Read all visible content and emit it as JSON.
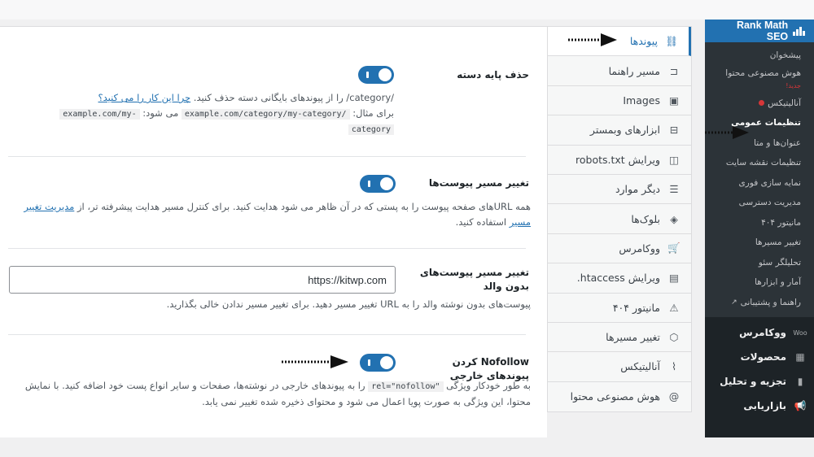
{
  "sidebar": {
    "brand": "Rank Math SEO",
    "submenu": [
      {
        "label": "پیشخوان"
      },
      {
        "label": "هوش مصنوعی محتوا",
        "badge": "جدید!"
      },
      {
        "label": "آنالیتیکس",
        "status_dot": true
      },
      {
        "label": "تنظیمات عمومی",
        "current": true
      },
      {
        "label": "عنوان‌ها و متا"
      },
      {
        "label": "تنظیمات نقشه سایت"
      },
      {
        "label": "نمایه سازی فوری"
      },
      {
        "label": "مدیریت دسترسی"
      },
      {
        "label": "مانیتور ۴۰۴"
      },
      {
        "label": "تغییر مسیرها"
      },
      {
        "label": "تحلیلگر سئو"
      },
      {
        "label": "آمار و ابزارها"
      },
      {
        "label": "راهنما و پشتیبانی",
        "external": true
      }
    ],
    "menu": [
      {
        "label": "ووکامرس",
        "icon": "woo-icon",
        "glyph": "Woo"
      },
      {
        "label": "محصولات",
        "icon": "archive-icon",
        "glyph": "▦"
      },
      {
        "label": "تجزیه و تحلیل",
        "icon": "chart-bar-icon",
        "glyph": "▮"
      },
      {
        "label": "بازاریابی",
        "icon": "megaphone-icon",
        "glyph": "📢"
      }
    ]
  },
  "tabs": [
    {
      "label": "پیوندها",
      "icon": "link-icon",
      "glyph": "⛓",
      "active": true
    },
    {
      "label": "مسیر راهنما",
      "icon": "signpost-icon",
      "glyph": "⊏"
    },
    {
      "label": "Images",
      "icon": "images-icon",
      "glyph": "▣"
    },
    {
      "label": "ابزارهای وبمستر",
      "icon": "toolbox-icon",
      "glyph": "⊟"
    },
    {
      "label": "ویرایش robots.txt",
      "icon": "robots-file-icon",
      "glyph": "◫"
    },
    {
      "label": "دیگر موارد",
      "icon": "list-circle-icon",
      "glyph": "☰"
    },
    {
      "label": "بلوک‌ها",
      "icon": "blocks-icon",
      "glyph": "◈"
    },
    {
      "label": "ووکامرس",
      "icon": "cart-icon",
      "glyph": "🛒"
    },
    {
      "label": "ویرایش htaccess.",
      "icon": "htaccess-file-icon",
      "glyph": "▤"
    },
    {
      "label": "مانیتور ۴۰۴",
      "icon": "warning-icon",
      "glyph": "⚠"
    },
    {
      "label": "تغییر مسیرها",
      "icon": "redirect-icon",
      "glyph": "⬡"
    },
    {
      "label": "آنالیتیکس",
      "icon": "analytics-icon",
      "glyph": "⌇"
    },
    {
      "label": "هوش مصنوعی محتوا",
      "icon": "ai-content-icon",
      "glyph": "@"
    }
  ],
  "settings": {
    "strip_category": {
      "label": "حذف پایه دسته",
      "enabled": true,
      "desc_prefix": "/category/ را از پیوندهای بایگانی دسته حذف کنید.",
      "desc_link": "چرا این کار را می کنید؟",
      "example_label": "برای مثال:",
      "example_code": "example.com/category/my-category/",
      "becomes_label": "می شود:",
      "result_code_1": "example.com/my-",
      "result_code_2": "category"
    },
    "redirect_attachments": {
      "label": "تغییر مسیر پیوست‌ها",
      "enabled": true,
      "desc": "همه URLهای صفحه پیوست را به پستی که در آن ظاهر می شود هدایت کنید. برای کنترل مسیر هدایت پیشرفته تر، از",
      "desc_link": "مدیریت تغییر مسیر",
      "desc_suffix": "استفاده کنید."
    },
    "redirect_orphan": {
      "label": "تغییر مسیر پیوست‌های بدون والد",
      "value": "https://kitwp.com",
      "desc": "پیوست‌های بدون نوشته والد را به URL تغییر مسیر دهید. برای تغییر مسیر ندادن خالی بگذارید."
    },
    "nofollow_external": {
      "label": "Nofollow کردن پیوندهای خارجی",
      "enabled": true,
      "desc_prefix": "به طور خودکار ویژگی",
      "code": "rel=\"nofollow\"",
      "desc_suffix": "را به پیوندهای خارجی در نوشته‌ها، صفحات و سایر انواع پست خود اضافه کنید. با نمایش محتوا، این ویژگی به صورت پویا اعمال می شود و محتوای ذخیره شده تغییر نمی یابد."
    }
  },
  "colors": {
    "accent": "#2271b1",
    "admin_bg": "#1d2327",
    "notify": "#d63638"
  }
}
